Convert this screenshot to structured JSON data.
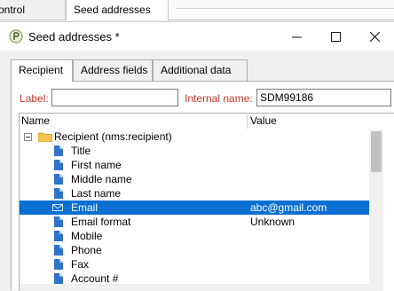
{
  "app_tabs": [
    {
      "label": "control group"
    },
    {
      "label": "Seed addresses"
    }
  ],
  "dialog": {
    "title": "Seed addresses *",
    "tabs": [
      {
        "label": "Recipient",
        "active": true
      },
      {
        "label": "Address fields",
        "active": false
      },
      {
        "label": "Additional data",
        "active": false
      }
    ],
    "label_caption": "Label:",
    "label_value": "",
    "internal_name_caption": "Internal name:",
    "internal_name_value": "SDM99186",
    "tree": {
      "col_name": "Name",
      "col_value": "Value",
      "root": "Recipient (nms:recipient)",
      "items": [
        {
          "name": "Title",
          "value": "",
          "icon": "field-icon"
        },
        {
          "name": "First name",
          "value": "",
          "icon": "field-icon"
        },
        {
          "name": "Middle name",
          "value": "",
          "icon": "field-icon"
        },
        {
          "name": "Last name",
          "value": "",
          "icon": "field-icon"
        },
        {
          "name": "Email",
          "value": "abc@gmail.com",
          "icon": "email-icon",
          "selected": true
        },
        {
          "name": "Email format",
          "value": "Unknown",
          "icon": "field-icon"
        },
        {
          "name": "Mobile",
          "value": "",
          "icon": "field-icon"
        },
        {
          "name": "Phone",
          "value": "",
          "icon": "field-icon"
        },
        {
          "name": "Fax",
          "value": "",
          "icon": "field-icon"
        },
        {
          "name": "Account #",
          "value": "",
          "icon": "field-icon"
        }
      ]
    }
  },
  "colors": {
    "selection": "#0a6fd1",
    "label_red": "#c0392b",
    "folder": "#f2c14e",
    "field_icon": "#2f74c8"
  }
}
